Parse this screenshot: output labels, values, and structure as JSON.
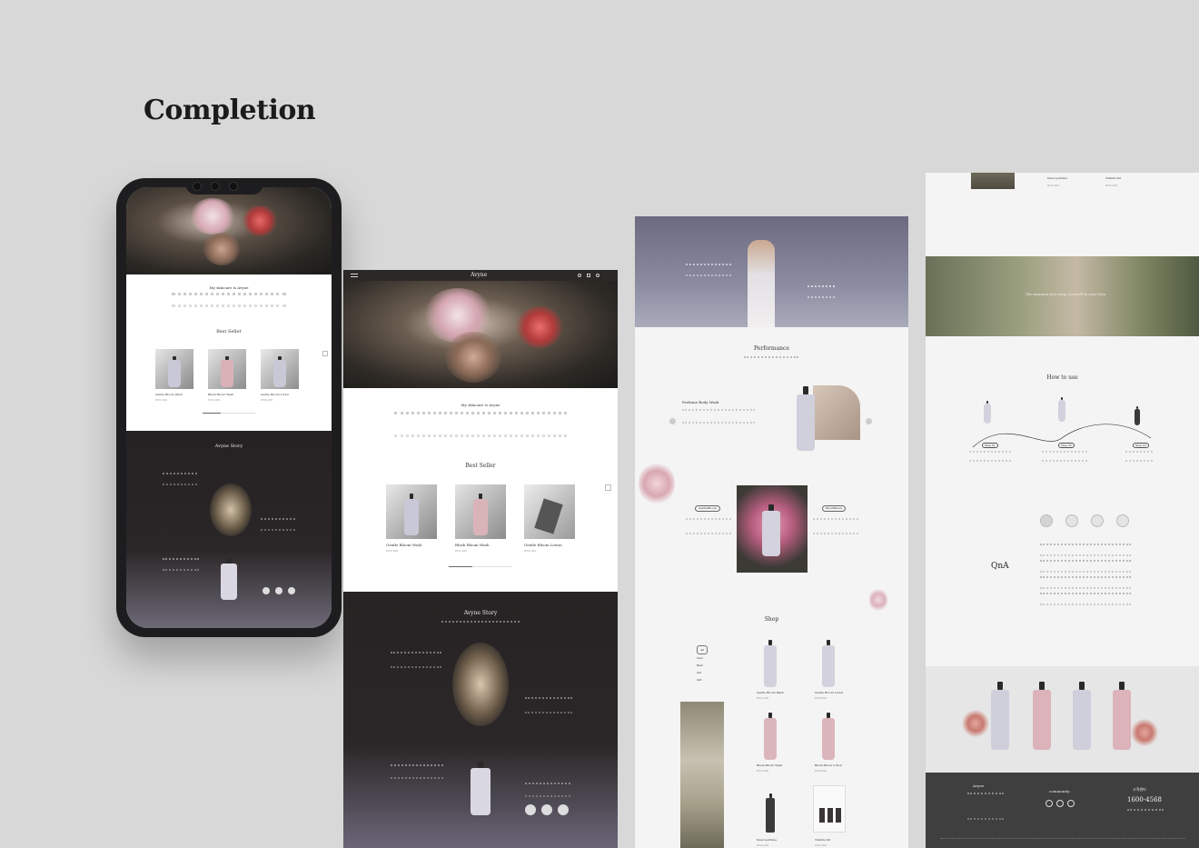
{
  "heading": "Completion",
  "phone": {
    "intro_title": "My skincare is Avyne",
    "best_seller": "Best Seller",
    "products": [
      {
        "name": "Gentle Bloom Wash",
        "price": "₩52,000"
      },
      {
        "name": "Blush Bloom Wash",
        "price": "₩52,000"
      },
      {
        "name": "Gentle Bloom Lotion",
        "price": "₩58,000"
      }
    ],
    "story_title": "Avyne Story"
  },
  "desktop1": {
    "brand": "Avyne",
    "intro_title": "My skincare is Avyne",
    "best_seller": "Best Seller",
    "products": [
      {
        "name": "Gentle Bloom Wash",
        "price": "₩52,000"
      },
      {
        "name": "Blush Bloom Wash",
        "price": "₩52,000"
      },
      {
        "name": "Gentle Bloom Lotion",
        "price": "₩58,000"
      }
    ],
    "story_title": "Avyne Story"
  },
  "desktop2": {
    "performance": "Performance",
    "feature": "Perfume Body Wash",
    "tag_gentle": "GentleBloom",
    "tag_blush": "BlushBloom",
    "shop": "Shop",
    "filters": [
      "All",
      "New",
      "Best",
      "Set",
      "Gift"
    ],
    "products": [
      {
        "name": "Gentle Bloom Wash",
        "price": "₩52,000"
      },
      {
        "name": "Gentle Bloom Lotion",
        "price": "₩58,000"
      },
      {
        "name": "Blush Bloom Wash",
        "price": "₩52,000"
      },
      {
        "name": "Blush Bloom Lotion",
        "price": "₩58,000"
      },
      {
        "name": "Inner perfume",
        "price": "₩32,000"
      },
      {
        "name": "Trabble Kit",
        "price": "₩45,000"
      }
    ]
  },
  "desktop3": {
    "top_products": [
      {
        "name": "Inner perfume",
        "price": "₩32,000"
      },
      {
        "name": "Trabble Kit",
        "price": "₩45,000"
      }
    ],
    "banner_text": "The moment you wrap yourself in your love.",
    "how_to_use": "How to use",
    "steps": [
      "Step 01",
      "Step 02",
      "Step 03"
    ],
    "qna": "QnA",
    "footer": {
      "brand": "Avyne",
      "community": "community",
      "cs_label": "고객센터",
      "phone": "1600-4568"
    }
  }
}
